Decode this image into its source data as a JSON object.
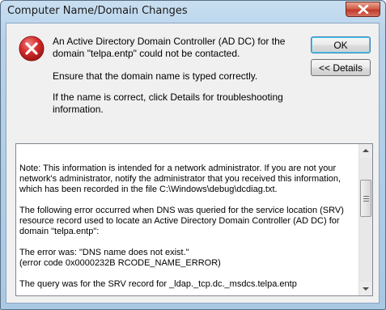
{
  "window": {
    "title": "Computer Name/Domain Changes"
  },
  "icons": {
    "error": "error-x-icon",
    "close": "close-icon"
  },
  "messages": [
    "An Active Directory Domain Controller (AD DC) for the domain \"telpa.entp\" could not be contacted.",
    "Ensure that the domain name is typed correctly.",
    "If the name is correct, click Details for troubleshooting information."
  ],
  "buttons": {
    "ok": "OK",
    "details": "<< Details"
  },
  "details": {
    "paragraphs": [
      "Note: This information is intended for a network administrator.  If you are not your network's administrator, notify the administrator that you received this information, which has been recorded in the file C:\\Windows\\debug\\dcdiag.txt.",
      "The following error occurred when DNS was queried for the service location (SRV) resource record used to locate an Active Directory Domain Controller (AD DC) for domain \"telpa.entp\":",
      "The error was: \"DNS name does not exist.\"\n(error code 0x0000232B RCODE_NAME_ERROR)",
      "The query was for the SRV record for _ldap._tcp.dc._msdcs.telpa.entp"
    ]
  },
  "colors": {
    "error_red": "#c8202a",
    "close_red": "#c0392b",
    "frame_blue": "#b7d2ea"
  }
}
